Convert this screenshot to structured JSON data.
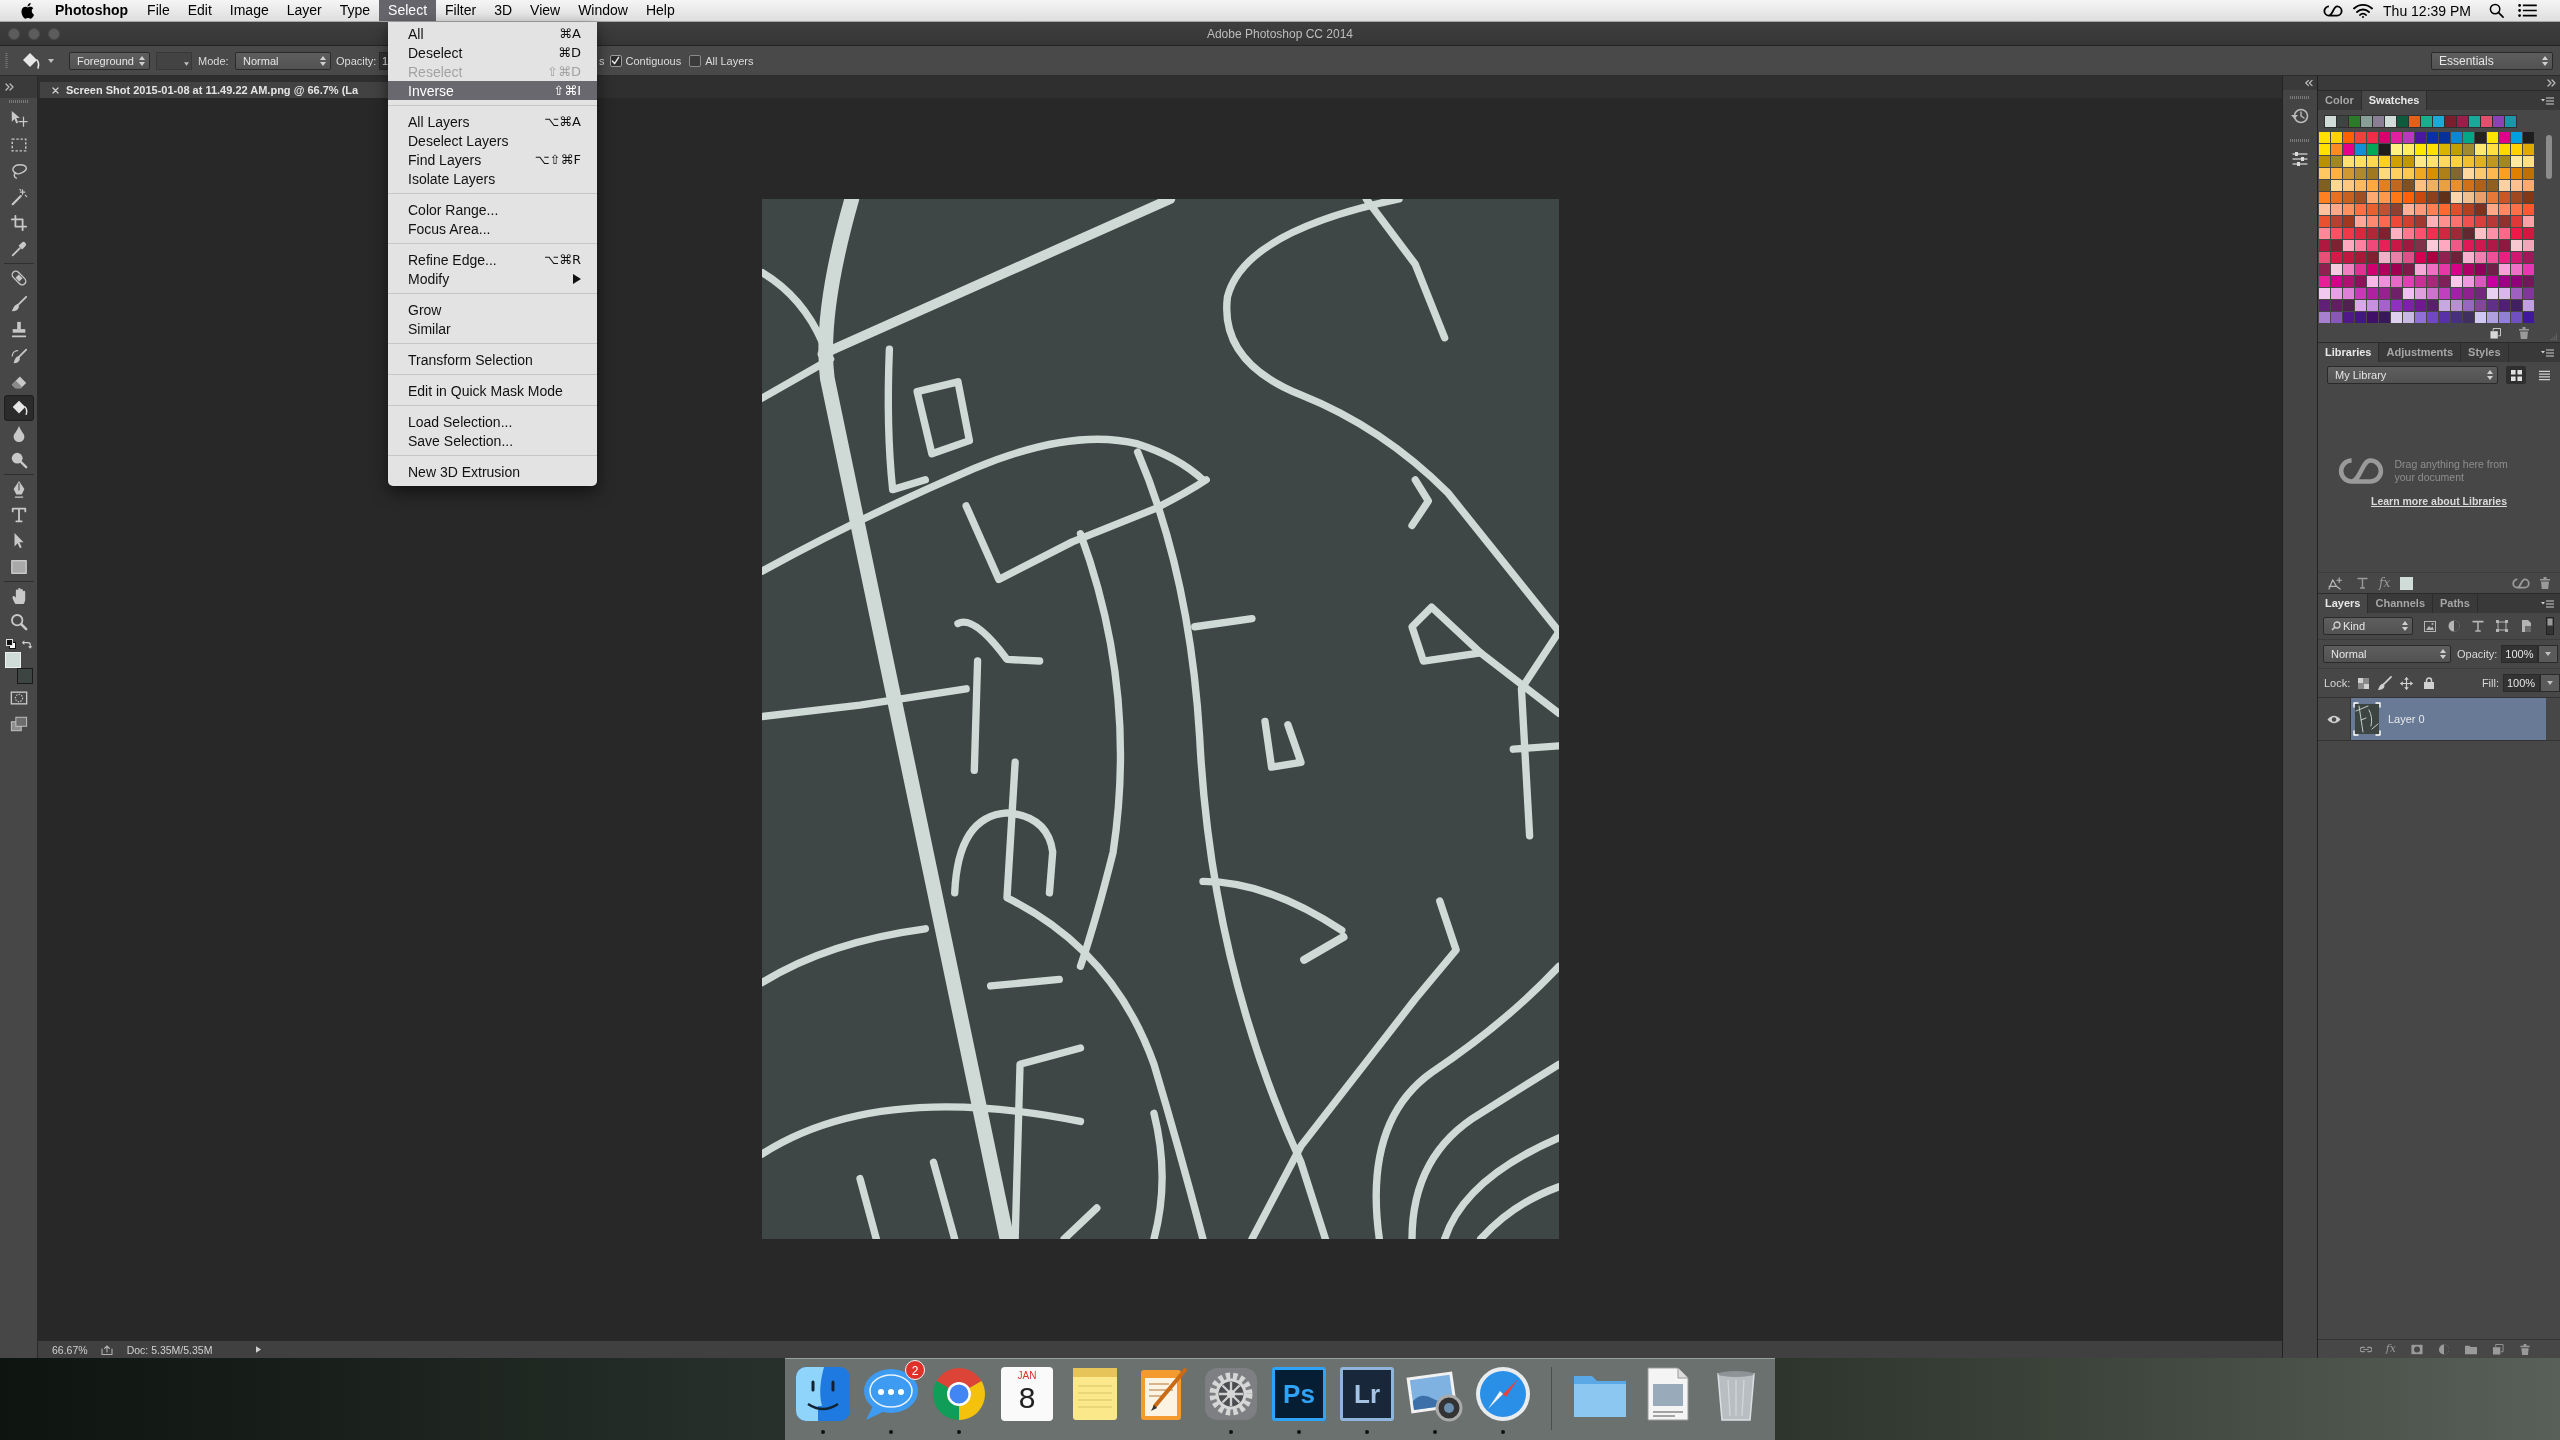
{
  "menu_bar": {
    "app_name": "Photoshop",
    "menus": [
      {
        "label": "File",
        "selected": false
      },
      {
        "label": "Edit",
        "selected": false
      },
      {
        "label": "Image",
        "selected": false
      },
      {
        "label": "Layer",
        "selected": false
      },
      {
        "label": "Type",
        "selected": false
      },
      {
        "label": "Select",
        "selected": true
      },
      {
        "label": "Filter",
        "selected": false
      },
      {
        "label": "3D",
        "selected": false
      },
      {
        "label": "View",
        "selected": false
      },
      {
        "label": "Window",
        "selected": false
      },
      {
        "label": "Help",
        "selected": false
      }
    ],
    "clock": "Thu 12:39 PM"
  },
  "window": {
    "title": "Adobe Photoshop CC 2014"
  },
  "options_bar": {
    "fill_source": "Foreground",
    "pattern_picker": {
      "disabled": true
    },
    "mode_label": "Mode:",
    "mode": "Normal",
    "opacity_label": "Opacity:",
    "opacity_value": "1",
    "cut_label": "s",
    "checkboxes": [
      {
        "label": "Contiguous",
        "checked": true
      },
      {
        "label": "All Layers",
        "checked": false
      }
    ],
    "workspace": "Essentials"
  },
  "select_menu": {
    "groups": [
      [
        {
          "label": "All",
          "shortcut": "⌘A",
          "disabled": false,
          "selected": false,
          "submenu": false
        },
        {
          "label": "Deselect",
          "shortcut": "⌘D",
          "disabled": false,
          "selected": false,
          "submenu": false
        },
        {
          "label": "Reselect",
          "shortcut": "⇧⌘D",
          "disabled": true,
          "selected": false,
          "submenu": false
        },
        {
          "label": "Inverse",
          "shortcut": "⇧⌘I",
          "disabled": false,
          "selected": true,
          "submenu": false
        }
      ],
      [
        {
          "label": "All Layers",
          "shortcut": "⌥⌘A",
          "disabled": false,
          "selected": false,
          "submenu": false
        },
        {
          "label": "Deselect Layers",
          "disabled": false,
          "selected": false,
          "submenu": false
        },
        {
          "label": "Find Layers",
          "shortcut": "⌥⇧⌘F",
          "disabled": false,
          "selected": false,
          "submenu": false
        },
        {
          "label": "Isolate Layers",
          "disabled": false,
          "selected": false,
          "submenu": false
        }
      ],
      [
        {
          "label": "Color Range...",
          "disabled": false,
          "selected": false,
          "submenu": false
        },
        {
          "label": "Focus Area...",
          "disabled": false,
          "selected": false,
          "submenu": false
        }
      ],
      [
        {
          "label": "Refine Edge...",
          "shortcut": "⌥⌘R",
          "disabled": false,
          "selected": false,
          "submenu": false
        },
        {
          "label": "Modify",
          "disabled": false,
          "selected": false,
          "submenu": true
        }
      ],
      [
        {
          "label": "Grow",
          "disabled": false,
          "selected": false,
          "submenu": false
        },
        {
          "label": "Similar",
          "disabled": false,
          "selected": false,
          "submenu": false
        }
      ],
      [
        {
          "label": "Transform Selection",
          "disabled": false,
          "selected": false,
          "submenu": false
        }
      ],
      [
        {
          "label": "Edit in Quick Mask Mode",
          "disabled": false,
          "selected": false,
          "submenu": false
        }
      ],
      [
        {
          "label": "Load Selection...",
          "disabled": false,
          "selected": false,
          "submenu": false
        },
        {
          "label": "Save Selection...",
          "disabled": false,
          "selected": false,
          "submenu": false
        }
      ],
      [
        {
          "label": "New 3D Extrusion",
          "disabled": false,
          "selected": false,
          "submenu": false
        }
      ]
    ]
  },
  "document": {
    "tab_title": "Screen Shot 2015-01-08 at 11.49.22 AM.png @ 66.7% (La"
  },
  "tools": {
    "groups": [
      [
        {
          "kind": "move",
          "selected": false
        },
        {
          "kind": "marquee",
          "selected": false
        },
        {
          "kind": "lasso",
          "selected": false
        },
        {
          "kind": "wand",
          "selected": false
        },
        {
          "kind": "crop",
          "selected": false
        },
        {
          "kind": "eyedropper",
          "selected": false
        }
      ],
      [
        {
          "kind": "healing",
          "selected": false
        },
        {
          "kind": "brush",
          "selected": false
        },
        {
          "kind": "stamp",
          "selected": false
        },
        {
          "kind": "historybrush",
          "selected": false
        },
        {
          "kind": "eraser",
          "selected": false
        },
        {
          "kind": "bucket",
          "selected": true
        },
        {
          "kind": "blur",
          "selected": false
        },
        {
          "kind": "dodge",
          "selected": false
        }
      ],
      [
        {
          "kind": "pen",
          "selected": false
        },
        {
          "kind": "type",
          "selected": false
        },
        {
          "kind": "pathselect",
          "selected": false
        },
        {
          "kind": "shape",
          "selected": false
        }
      ],
      [
        {
          "kind": "hand",
          "selected": false
        },
        {
          "kind": "zoom",
          "selected": false
        }
      ]
    ],
    "colors": [
      {
        "kind": "foreground",
        "color": "#d0dcd8"
      },
      {
        "kind": "background",
        "color": "#3d4543"
      }
    ],
    "modes": [
      {
        "kind": "quickmask"
      },
      {
        "kind": "screenmode"
      }
    ]
  },
  "status_bar": {
    "zoom": "66.67%",
    "doc_info": "Doc: 5.35M/5.35M"
  },
  "swatches_panel": {
    "tabs": [
      {
        "label": "Color",
        "selected": false
      },
      {
        "label": "Swatches",
        "selected": true
      }
    ],
    "recent": [
      {
        "color": "#d0dcd8"
      },
      {
        "color": "#3d4543"
      },
      {
        "color": "#2a7a2a"
      },
      {
        "color": "#8a9e98"
      },
      {
        "color": "#8a7e94"
      },
      {
        "color": "#d0dcd8"
      },
      {
        "color": "#0e5a3c"
      },
      {
        "color": "#e0601c"
      },
      {
        "color": "#1aae8e"
      },
      {
        "color": "#1ea8d4"
      },
      {
        "color": "#7a1e2e"
      },
      {
        "color": "#9a1e4a"
      },
      {
        "color": "#1aa89a"
      },
      {
        "color": "#e0506e"
      },
      {
        "color": "#8a42b4"
      },
      {
        "color": "#1a96a8"
      }
    ],
    "grid": [
      [
        {
          "color": "#ffe000"
        },
        {
          "color": "#ffd400"
        },
        {
          "color": "#ff6000"
        },
        {
          "color": "#f04040"
        },
        {
          "color": "#f02c48"
        },
        {
          "color": "#d8006a"
        },
        {
          "color": "#e020a0"
        },
        {
          "color": "#b838c0"
        },
        {
          "color": "#4a18a0"
        },
        {
          "color": "#0830a8"
        },
        {
          "color": "#06309a"
        },
        {
          "color": "#0a88d0"
        },
        {
          "color": "#00a888"
        },
        {
          "color": "#262222"
        },
        {
          "color": "#ffe400"
        },
        {
          "color": "#e0008a"
        },
        {
          "color": "#00a0e0"
        },
        {
          "color": "#1e1e1e"
        }
      ],
      [
        {
          "color": "#ffe000"
        },
        {
          "color": "#ff8a20"
        },
        {
          "color": "#e8008a"
        },
        {
          "color": "#1090d8"
        },
        {
          "color": "#00a858"
        },
        {
          "color": "#1e1e1e"
        },
        {
          "color": "#fff080"
        },
        {
          "color": "#ffee60"
        },
        {
          "color": "#ffe800"
        },
        {
          "color": "#ffe000"
        },
        {
          "color": "#d8b400"
        },
        {
          "color": "#c0a000"
        },
        {
          "color": "#a08a30"
        },
        {
          "color": "#ffe870"
        },
        {
          "color": "#ffe040"
        },
        {
          "color": "#ffd800"
        },
        {
          "color": "#ffd200"
        },
        {
          "color": "#e0a800"
        }
      ],
      [
        {
          "color": "#b89000"
        },
        {
          "color": "#a08820"
        },
        {
          "color": "#ffe070"
        },
        {
          "color": "#ffe060"
        },
        {
          "color": "#ffd850"
        },
        {
          "color": "#ffd020"
        },
        {
          "color": "#d0a000"
        },
        {
          "color": "#c09800"
        },
        {
          "color": "#ffe888"
        },
        {
          "color": "#ffe070"
        },
        {
          "color": "#ffd860"
        },
        {
          "color": "#ffd040"
        },
        {
          "color": "#f0c030"
        },
        {
          "color": "#e0b020"
        },
        {
          "color": "#c09820"
        },
        {
          "color": "#a08a20"
        },
        {
          "color": "#ffe8a0"
        },
        {
          "color": "#ffe080"
        }
      ],
      [
        {
          "color": "#ffc860"
        },
        {
          "color": "#ffb040"
        },
        {
          "color": "#d09830"
        },
        {
          "color": "#b08830"
        },
        {
          "color": "#a07820"
        },
        {
          "color": "#ffd880"
        },
        {
          "color": "#ffd060"
        },
        {
          "color": "#ffc850"
        },
        {
          "color": "#f0a820"
        },
        {
          "color": "#d89000"
        },
        {
          "color": "#b08018"
        },
        {
          "color": "#806830"
        },
        {
          "color": "#ffd8a0"
        },
        {
          "color": "#ffc870"
        },
        {
          "color": "#ffb850"
        },
        {
          "color": "#f8a020"
        },
        {
          "color": "#e08000"
        },
        {
          "color": "#c07000"
        }
      ],
      [
        {
          "color": "#806020"
        },
        {
          "color": "#ffd890"
        },
        {
          "color": "#ffc880"
        },
        {
          "color": "#ffb860"
        },
        {
          "color": "#ffa840"
        },
        {
          "color": "#e08020"
        },
        {
          "color": "#c06820"
        },
        {
          "color": "#805020"
        },
        {
          "color": "#ffc080"
        },
        {
          "color": "#f0b060"
        },
        {
          "color": "#e8a040"
        },
        {
          "color": "#e89030"
        },
        {
          "color": "#d07018"
        },
        {
          "color": "#b06018"
        },
        {
          "color": "#906020"
        },
        {
          "color": "#ffd0a0"
        },
        {
          "color": "#ffc090"
        },
        {
          "color": "#ffa870"
        }
      ],
      [
        {
          "color": "#ff8020"
        },
        {
          "color": "#e87020"
        },
        {
          "color": "#c86020"
        },
        {
          "color": "#a05020"
        },
        {
          "color": "#ffa870"
        },
        {
          "color": "#ff9850"
        },
        {
          "color": "#ff7818"
        },
        {
          "color": "#ff6008"
        },
        {
          "color": "#c84810"
        },
        {
          "color": "#904018"
        },
        {
          "color": "#603018"
        },
        {
          "color": "#f8d8a8"
        },
        {
          "color": "#f0c090"
        },
        {
          "color": "#e8a068"
        },
        {
          "color": "#e87838"
        },
        {
          "color": "#c85828"
        },
        {
          "color": "#a04820"
        },
        {
          "color": "#803818"
        }
      ],
      [
        {
          "color": "#ffc0a0"
        },
        {
          "color": "#ffa888"
        },
        {
          "color": "#ff9060"
        },
        {
          "color": "#ff7040"
        },
        {
          "color": "#e86030"
        },
        {
          "color": "#c05030"
        },
        {
          "color": "#904030"
        },
        {
          "color": "#ffb098"
        },
        {
          "color": "#ff9878"
        },
        {
          "color": "#ff8050"
        },
        {
          "color": "#ff6830"
        },
        {
          "color": "#e05028"
        },
        {
          "color": "#b04020"
        },
        {
          "color": "#803020"
        },
        {
          "color": "#ffa888"
        },
        {
          "color": "#ff8860"
        },
        {
          "color": "#ff7048"
        },
        {
          "color": "#ff5830"
        }
      ],
      [
        {
          "color": "#e85030"
        },
        {
          "color": "#b84030"
        },
        {
          "color": "#a03820"
        },
        {
          "color": "#ffa898"
        },
        {
          "color": "#ff8870"
        },
        {
          "color": "#ff6850"
        },
        {
          "color": "#f04838"
        },
        {
          "color": "#d04030"
        },
        {
          "color": "#a03830"
        },
        {
          "color": "#ffb0b8"
        },
        {
          "color": "#ff9090"
        },
        {
          "color": "#ff7070"
        },
        {
          "color": "#f05050"
        },
        {
          "color": "#d84040"
        },
        {
          "color": "#b83838"
        },
        {
          "color": "#903030"
        },
        {
          "color": "#e03838"
        },
        {
          "color": "#ffa0a8"
        }
      ],
      [
        {
          "color": "#ff8898"
        },
        {
          "color": "#ff5068"
        },
        {
          "color": "#f03848"
        },
        {
          "color": "#d82840"
        },
        {
          "color": "#b02838"
        },
        {
          "color": "#802030"
        },
        {
          "color": "#ffb0c0"
        },
        {
          "color": "#ff7890"
        },
        {
          "color": "#ff5070"
        },
        {
          "color": "#f03050"
        },
        {
          "color": "#d02840"
        },
        {
          "color": "#a02838"
        },
        {
          "color": "#602830"
        },
        {
          "color": "#ffc0c8"
        },
        {
          "color": "#ff90a8"
        },
        {
          "color": "#ff6888"
        },
        {
          "color": "#f01848"
        },
        {
          "color": "#d01840"
        }
      ],
      [
        {
          "color": "#b01840"
        },
        {
          "color": "#802030"
        },
        {
          "color": "#ffa8c0"
        },
        {
          "color": "#ff80a0"
        },
        {
          "color": "#f04878"
        },
        {
          "color": "#e82058"
        },
        {
          "color": "#c81848"
        },
        {
          "color": "#a01840"
        },
        {
          "color": "#803048"
        },
        {
          "color": "#ffc8d8"
        },
        {
          "color": "#ffa8c0"
        },
        {
          "color": "#f05888"
        },
        {
          "color": "#e01858"
        },
        {
          "color": "#d01850"
        },
        {
          "color": "#b01848"
        },
        {
          "color": "#901840"
        },
        {
          "color": "#f8c8d0"
        },
        {
          "color": "#f0a8b8"
        }
      ],
      [
        {
          "color": "#e85078"
        },
        {
          "color": "#d81848"
        },
        {
          "color": "#c01840"
        },
        {
          "color": "#a81838"
        },
        {
          "color": "#802030"
        },
        {
          "color": "#f0b0c8"
        },
        {
          "color": "#e880a8"
        },
        {
          "color": "#e05088"
        },
        {
          "color": "#d80050"
        },
        {
          "color": "#a80040"
        },
        {
          "color": "#902050"
        },
        {
          "color": "#702038"
        },
        {
          "color": "#f8b0d0"
        },
        {
          "color": "#f080b0"
        },
        {
          "color": "#f05098"
        },
        {
          "color": "#e82080"
        },
        {
          "color": "#d01870"
        },
        {
          "color": "#a01858"
        }
      ],
      [
        {
          "color": "#902050"
        },
        {
          "color": "#f8c8e0"
        },
        {
          "color": "#f080c0"
        },
        {
          "color": "#e03090"
        },
        {
          "color": "#d00070"
        },
        {
          "color": "#b00058"
        },
        {
          "color": "#a00050"
        },
        {
          "color": "#801848"
        },
        {
          "color": "#f8a8d8"
        },
        {
          "color": "#f070c0"
        },
        {
          "color": "#e838a8"
        },
        {
          "color": "#d80088"
        },
        {
          "color": "#b00068"
        },
        {
          "color": "#900058"
        },
        {
          "color": "#702048"
        },
        {
          "color": "#f8a0d8"
        },
        {
          "color": "#f070c8"
        },
        {
          "color": "#e838b0"
        }
      ],
      [
        {
          "color": "#e82098"
        },
        {
          "color": "#d00088"
        },
        {
          "color": "#b01070"
        },
        {
          "color": "#901058"
        },
        {
          "color": "#f8b8e8"
        },
        {
          "color": "#f090d8"
        },
        {
          "color": "#e868c8"
        },
        {
          "color": "#e040b0"
        },
        {
          "color": "#c83098"
        },
        {
          "color": "#a82878"
        },
        {
          "color": "#802058"
        },
        {
          "color": "#f8c8e8"
        },
        {
          "color": "#f098e0"
        },
        {
          "color": "#d858c0"
        },
        {
          "color": "#c800a0"
        },
        {
          "color": "#a00088"
        },
        {
          "color": "#900078"
        },
        {
          "color": "#701858"
        }
      ],
      [
        {
          "color": "#f0c8f0"
        },
        {
          "color": "#e8a0e0"
        },
        {
          "color": "#e080d8"
        },
        {
          "color": "#c838b8"
        },
        {
          "color": "#b020a0"
        },
        {
          "color": "#982090"
        },
        {
          "color": "#702068"
        },
        {
          "color": "#f0c0f0"
        },
        {
          "color": "#e0a0e0"
        },
        {
          "color": "#d070d0"
        },
        {
          "color": "#c040c0"
        },
        {
          "color": "#a020a8"
        },
        {
          "color": "#902090"
        },
        {
          "color": "#702878"
        },
        {
          "color": "#e8d0f0"
        },
        {
          "color": "#d8b8e8"
        },
        {
          "color": "#a060c0"
        },
        {
          "color": "#803898"
        }
      ],
      [
        {
          "color": "#602078"
        },
        {
          "color": "#602060"
        },
        {
          "color": "#502050"
        },
        {
          "color": "#d8a8e8"
        },
        {
          "color": "#c890e0"
        },
        {
          "color": "#a860d0"
        },
        {
          "color": "#9030c0"
        },
        {
          "color": "#8020a8"
        },
        {
          "color": "#701890"
        },
        {
          "color": "#582068"
        },
        {
          "color": "#c8a8e0"
        },
        {
          "color": "#b890d0"
        },
        {
          "color": "#9868c0"
        },
        {
          "color": "#804898"
        },
        {
          "color": "#603088"
        },
        {
          "color": "#502078"
        },
        {
          "color": "#402060"
        },
        {
          "color": "#c0a0e0"
        }
      ],
      [
        {
          "color": "#a880d0"
        },
        {
          "color": "#8858b8"
        },
        {
          "color": "#501888"
        },
        {
          "color": "#401880"
        },
        {
          "color": "#401068"
        },
        {
          "color": "#381858"
        },
        {
          "color": "#e0d0f0"
        },
        {
          "color": "#c8b8e8"
        },
        {
          "color": "#9070d8"
        },
        {
          "color": "#7048c0"
        },
        {
          "color": "#5830a8"
        },
        {
          "color": "#483080"
        },
        {
          "color": "#403060"
        },
        {
          "color": "#d0c8f0"
        },
        {
          "color": "#b0a0e0"
        },
        {
          "color": "#9080d8"
        },
        {
          "color": "#7050c0"
        },
        {
          "color": "#4018a0"
        }
      ]
    ]
  },
  "libraries_panel": {
    "tabs": [
      {
        "label": "Libraries",
        "selected": true
      },
      {
        "label": "Adjustments",
        "selected": false
      },
      {
        "label": "Styles",
        "selected": false
      }
    ],
    "library": "My Library",
    "views": [
      {
        "kind": "grid",
        "selected": true
      },
      {
        "kind": "list",
        "selected": false
      }
    ],
    "message": "Drag anything here from your document",
    "link": "Learn more about Libraries",
    "footer_fx": "fx",
    "footer_swatch": {
      "color": "#d0dcd8"
    }
  },
  "layers_panel": {
    "tabs": [
      {
        "label": "Layers",
        "selected": true
      },
      {
        "label": "Channels",
        "selected": false
      },
      {
        "label": "Paths",
        "selected": false
      }
    ],
    "filter": "Kind",
    "blend_mode": "Normal",
    "opacity_label": "Opacity:",
    "opacity": "100%",
    "lock_label": "Lock:",
    "fill_label": "Fill:",
    "fill": "100%",
    "layers": [
      {
        "name": "Layer 0",
        "visible": true,
        "selected": true
      }
    ],
    "footer_fx": "fx"
  },
  "dock": {
    "items": [
      {
        "kind": "finder",
        "running": true
      },
      {
        "kind": "messages",
        "running": true,
        "badge": "2"
      },
      {
        "kind": "browser",
        "running": true
      },
      {
        "kind": "calendar",
        "running": false,
        "month": "JAN",
        "day": "8"
      },
      {
        "kind": "notes",
        "running": false
      },
      {
        "kind": "pages",
        "running": false
      },
      {
        "kind": "settings",
        "running": true
      },
      {
        "kind": "photoshop",
        "running": true,
        "label": "Ps"
      },
      {
        "kind": "lightroom",
        "running": true,
        "label": "Lr"
      },
      {
        "kind": "photos",
        "running": true
      },
      {
        "kind": "compass",
        "running": true
      },
      {
        "kind": "separator"
      },
      {
        "kind": "folder",
        "running": false
      },
      {
        "kind": "document",
        "running": false
      },
      {
        "kind": "trash",
        "running": false
      }
    ]
  }
}
